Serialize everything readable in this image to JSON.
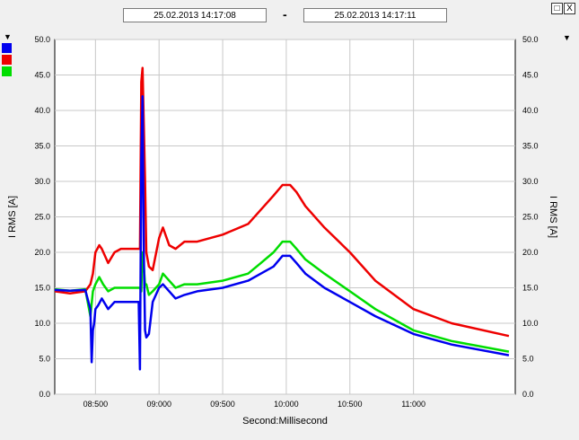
{
  "header": {
    "start_time": "25.02.2013      14:17:08",
    "separator": "-",
    "end_time": "25.02.2013      14:17:11",
    "maximize_symbol": "□",
    "close_symbol": "X"
  },
  "legend_swatches": [
    {
      "color": "#0000ee"
    },
    {
      "color": "#ee0000"
    },
    {
      "color": "#00dd00"
    }
  ],
  "chart_data": {
    "type": "line",
    "xlabel": "Second:Millisecond",
    "ylabel": "I RMS [A]",
    "ylim": [
      0,
      50
    ],
    "xlim": [
      8.18,
      11.8
    ],
    "y_ticks": [
      "0.0",
      "5.0",
      "10.0",
      "15.0",
      "20.0",
      "25.0",
      "30.0",
      "35.0",
      "40.0",
      "45.0",
      "50.0"
    ],
    "x_ticks": [
      {
        "value": 8.5,
        "label": "08:500"
      },
      {
        "value": 9.0,
        "label": "09:000"
      },
      {
        "value": 9.5,
        "label": "09:500"
      },
      {
        "value": 10.0,
        "label": "10:000"
      },
      {
        "value": 10.5,
        "label": "10:500"
      },
      {
        "value": 11.0,
        "label": "11:000"
      }
    ],
    "grid": true,
    "series": [
      {
        "color": "#ee0000",
        "x": [
          8.18,
          8.3,
          8.42,
          8.46,
          8.48,
          8.5,
          8.53,
          8.55,
          8.6,
          8.65,
          8.7,
          8.78,
          8.85,
          8.86,
          8.87,
          8.88,
          8.89,
          8.9,
          8.92,
          8.95,
          9.0,
          9.03,
          9.08,
          9.13,
          9.2,
          9.3,
          9.5,
          9.7,
          9.8,
          9.9,
          9.97,
          10.03,
          10.08,
          10.15,
          10.3,
          10.5,
          10.7,
          11.0,
          11.3,
          11.75
        ],
        "y": [
          14.5,
          14.2,
          14.5,
          15.5,
          17.0,
          20.0,
          21.0,
          20.5,
          18.5,
          20.0,
          20.5,
          20.5,
          20.5,
          44.0,
          46.0,
          38.0,
          30.0,
          20.0,
          18.0,
          17.5,
          22.0,
          23.5,
          21.0,
          20.5,
          21.5,
          21.5,
          22.5,
          24.0,
          26.0,
          28.0,
          29.5,
          29.5,
          28.5,
          26.5,
          23.5,
          20.0,
          16.0,
          12.0,
          10.0,
          8.2
        ]
      },
      {
        "color": "#00dd00",
        "x": [
          8.18,
          8.3,
          8.42,
          8.46,
          8.48,
          8.5,
          8.53,
          8.56,
          8.6,
          8.65,
          8.7,
          8.78,
          8.85,
          8.86,
          8.87,
          8.88,
          8.89,
          8.9,
          8.92,
          8.95,
          9.0,
          9.03,
          9.08,
          9.13,
          9.2,
          9.3,
          9.5,
          9.7,
          9.8,
          9.9,
          9.97,
          10.03,
          10.08,
          10.15,
          10.3,
          10.5,
          10.7,
          11.0,
          11.3,
          11.75
        ],
        "y": [
          14.8,
          14.6,
          14.8,
          11.0,
          14.5,
          15.5,
          16.5,
          15.5,
          14.5,
          15.0,
          15.0,
          15.0,
          15.0,
          14.5,
          20.0,
          18.0,
          15.5,
          15.5,
          14.0,
          14.5,
          15.5,
          17.0,
          16.0,
          15.0,
          15.5,
          15.5,
          16.0,
          17.0,
          18.5,
          20.0,
          21.5,
          21.5,
          20.5,
          19.0,
          17.0,
          14.5,
          12.0,
          9.0,
          7.5,
          6.0
        ]
      },
      {
        "color": "#0000ee",
        "x": [
          8.18,
          8.3,
          8.42,
          8.46,
          8.47,
          8.48,
          8.49,
          8.5,
          8.52,
          8.55,
          8.6,
          8.65,
          8.7,
          8.78,
          8.84,
          8.85,
          8.86,
          8.87,
          8.88,
          8.89,
          8.9,
          8.92,
          8.95,
          9.0,
          9.03,
          9.08,
          9.13,
          9.2,
          9.3,
          9.5,
          9.7,
          9.8,
          9.9,
          9.97,
          10.03,
          10.08,
          10.15,
          10.3,
          10.5,
          10.7,
          11.0,
          11.3,
          11.75
        ],
        "y": [
          14.7,
          14.6,
          14.7,
          12.0,
          4.5,
          9.0,
          10.0,
          12.0,
          12.5,
          13.5,
          12.0,
          13.0,
          13.0,
          13.0,
          13.0,
          3.5,
          33.0,
          42.0,
          20.0,
          9.0,
          8.0,
          8.5,
          13.0,
          15.0,
          15.5,
          14.5,
          13.5,
          14.0,
          14.5,
          15.0,
          16.0,
          17.0,
          18.0,
          19.5,
          19.5,
          18.5,
          17.0,
          15.0,
          13.0,
          11.0,
          8.5,
          7.0,
          5.5
        ]
      }
    ]
  }
}
